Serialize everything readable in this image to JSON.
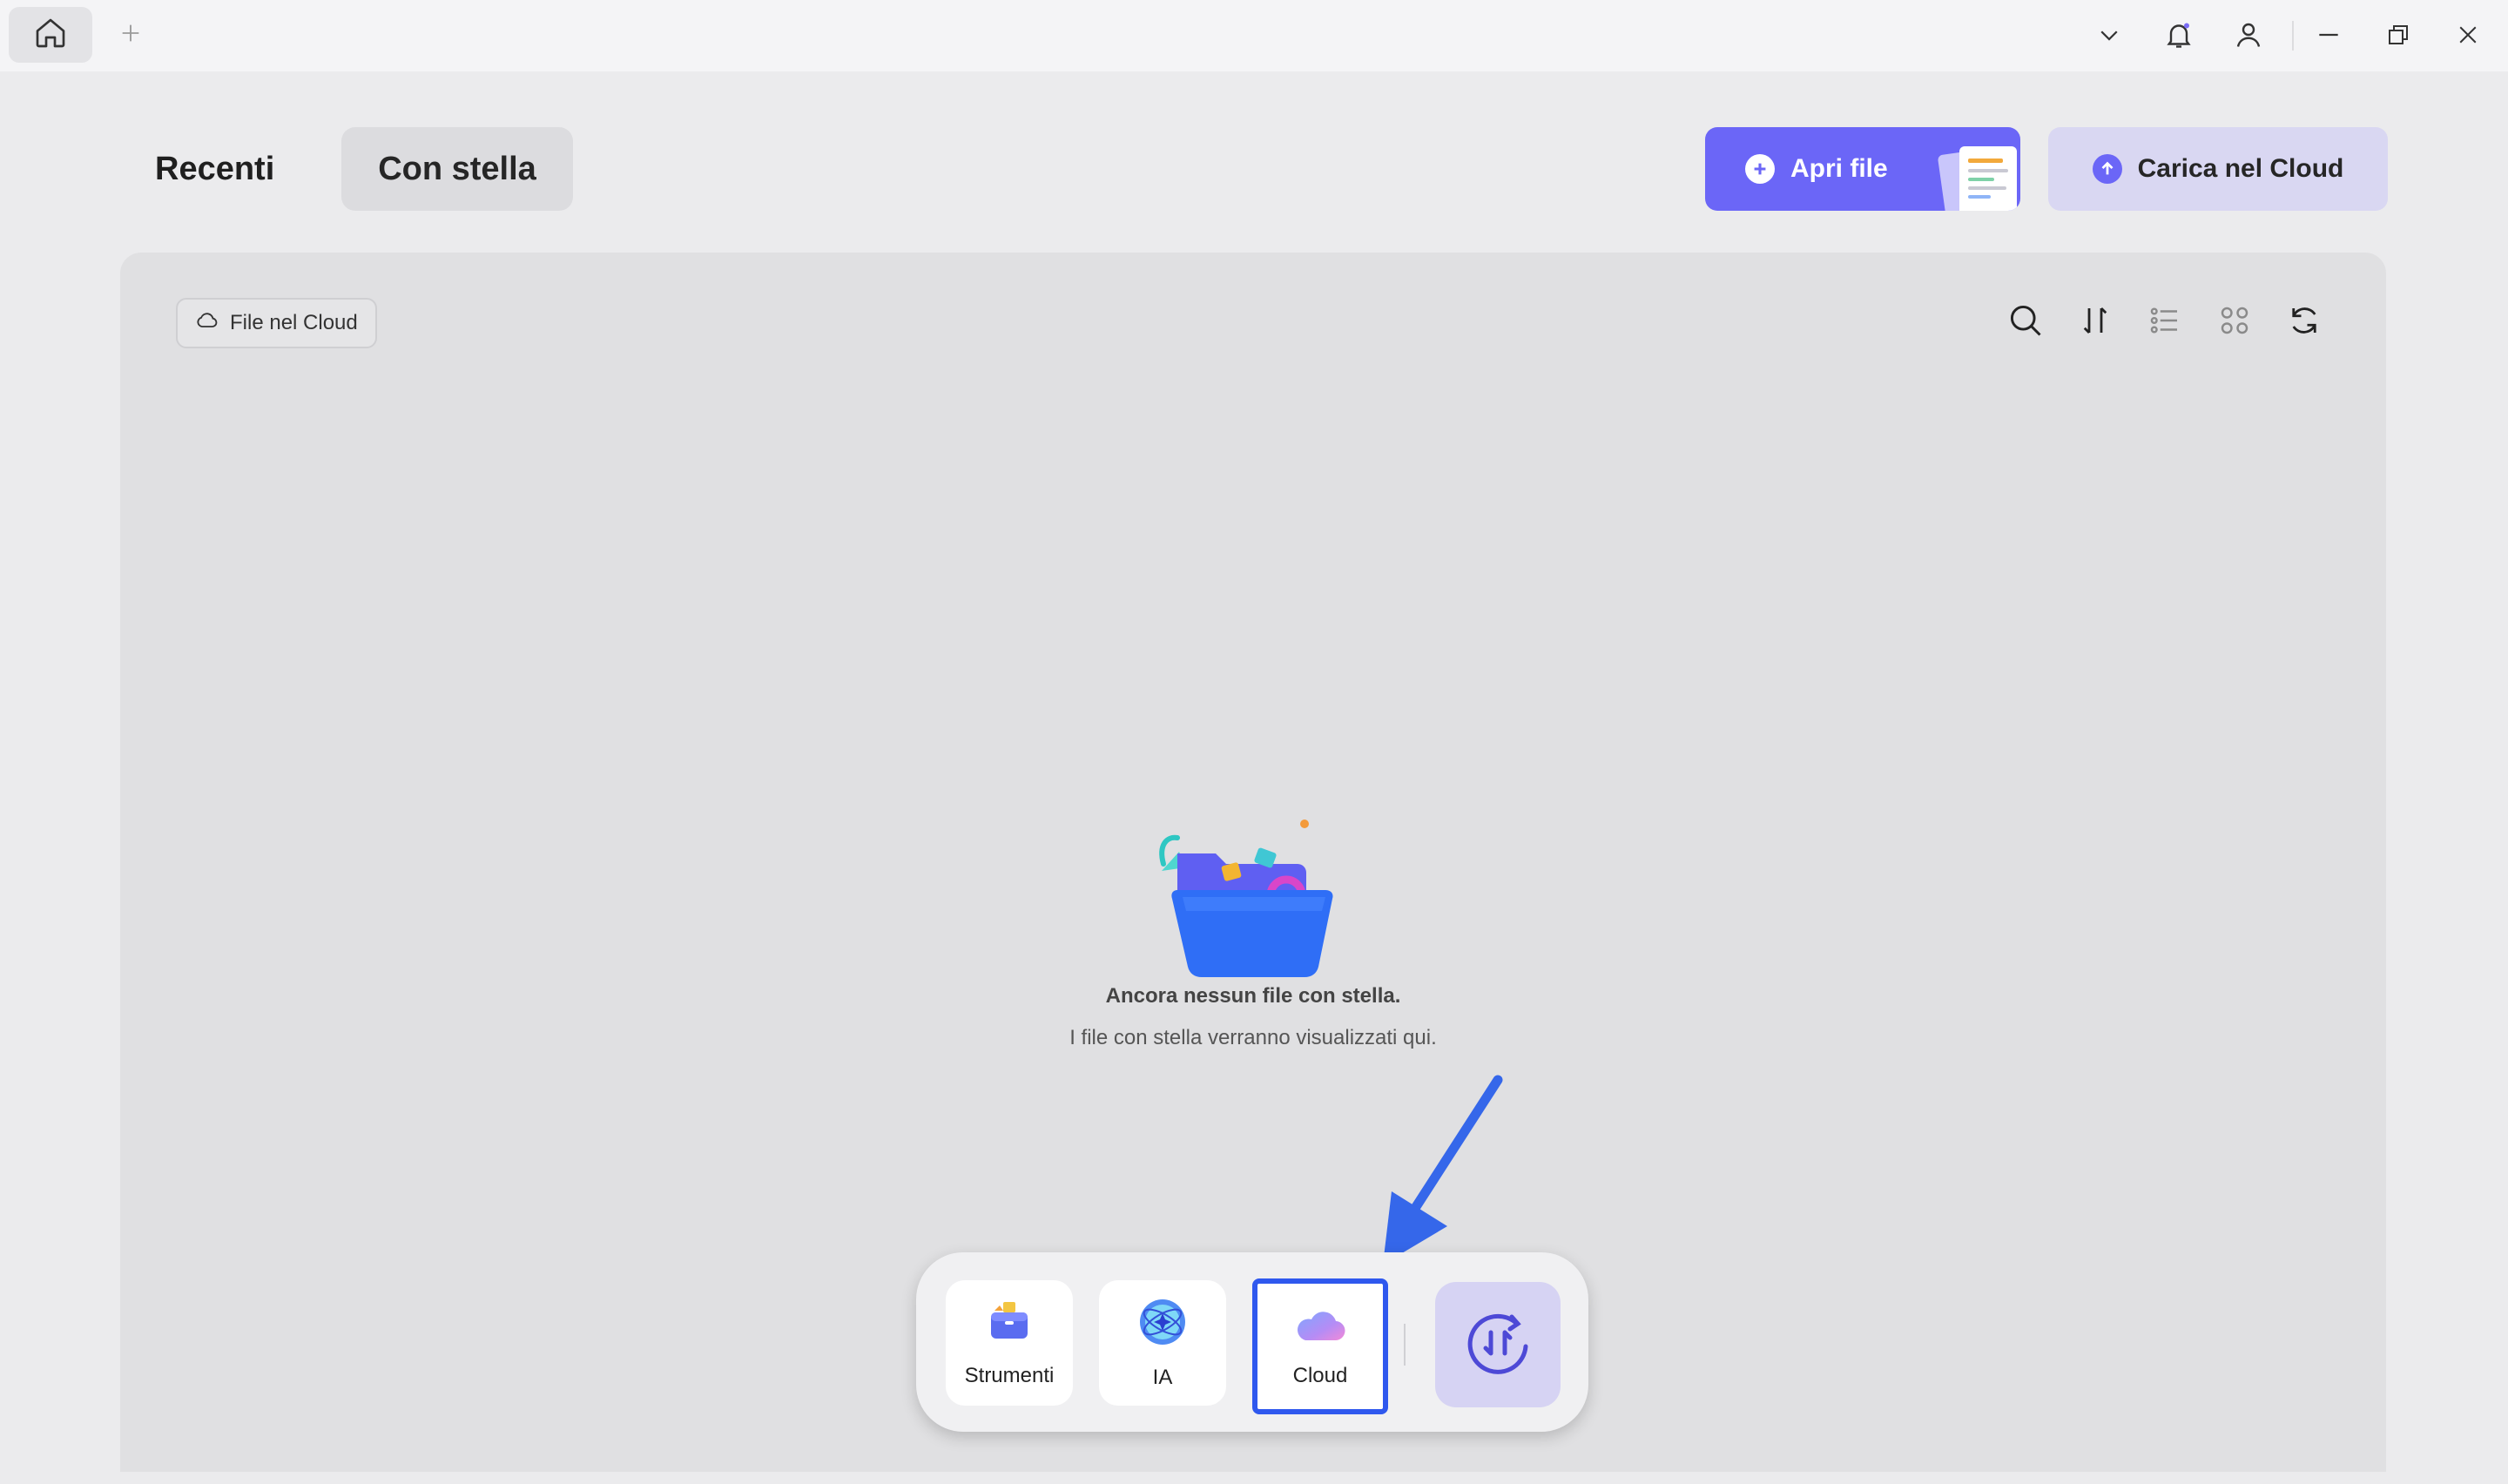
{
  "titlebar": {
    "home_icon": "home-icon",
    "new_tab_icon": "plus-icon",
    "controls": [
      "chevron-down-icon",
      "bell-icon",
      "user-icon",
      "minimize-icon",
      "restore-icon",
      "close-icon"
    ]
  },
  "header": {
    "tabs": [
      {
        "label": "Recenti",
        "active": false
      },
      {
        "label": "Con stella",
        "active": true
      }
    ],
    "open_file_label": "Apri file",
    "upload_cloud_label": "Carica nel Cloud"
  },
  "panel": {
    "filter_chip_label": "File nel Cloud",
    "toolbar": [
      "search-icon",
      "sort-icon",
      "list-view-icon",
      "grid-view-icon",
      "refresh-icon"
    ],
    "empty_title": "Ancora nessun file con stella.",
    "empty_subtitle": "I file con stella verranno visualizzati qui."
  },
  "dock": {
    "items": [
      {
        "label": "Strumenti",
        "icon": "toolbox-icon"
      },
      {
        "label": "IA",
        "icon": "ai-orb-icon"
      },
      {
        "label": "Cloud",
        "icon": "cloud-icon",
        "selected": true
      }
    ],
    "convert_icon": "convert-icon"
  },
  "colors": {
    "accent": "#6b66f7",
    "accent_light": "#d9d7f2",
    "highlight": "#2f58ee"
  }
}
